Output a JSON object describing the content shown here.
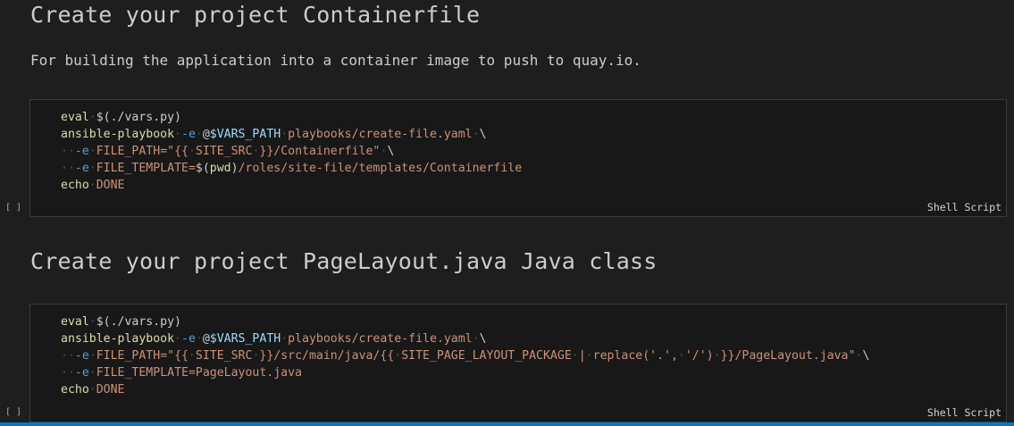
{
  "cells": [
    {
      "type": "markdown",
      "heading": "Create your project Containerfile",
      "paragraph": "For building the application into a container image to push to quay.io."
    },
    {
      "type": "code",
      "execution_count": "[ ]",
      "language": "Shell Script",
      "lines": [
        [
          [
            "cmd",
            "eval"
          ],
          [
            "ws",
            "·"
          ],
          [
            "plain",
            "$(./vars.py)"
          ]
        ],
        [
          [
            "cmd",
            "ansible-playbook"
          ],
          [
            "ws",
            "·"
          ],
          [
            "flag",
            "-e"
          ],
          [
            "ws",
            "·"
          ],
          [
            "plain",
            "@"
          ],
          [
            "var",
            "$VARS_PATH"
          ],
          [
            "ws",
            "·"
          ],
          [
            "str",
            "playbooks/create-file.yaml"
          ],
          [
            "ws",
            "·"
          ],
          [
            "plain",
            "\\"
          ]
        ],
        [
          [
            "ws",
            "··"
          ],
          [
            "flag",
            "-e"
          ],
          [
            "ws",
            "·"
          ],
          [
            "str",
            "FILE_PATH=\"{{"
          ],
          [
            "ws",
            "·"
          ],
          [
            "str",
            "SITE_SRC"
          ],
          [
            "ws",
            "·"
          ],
          [
            "str",
            "}}/Containerfile\""
          ],
          [
            "ws",
            "·"
          ],
          [
            "plain",
            "\\"
          ]
        ],
        [
          [
            "ws",
            "··"
          ],
          [
            "flag",
            "-e"
          ],
          [
            "ws",
            "·"
          ],
          [
            "str",
            "FILE_TEMPLATE="
          ],
          [
            "plain",
            "$("
          ],
          [
            "cmd",
            "pwd"
          ],
          [
            "plain",
            ")"
          ],
          [
            "str",
            "/roles/site-file/templates/Containerfile"
          ]
        ],
        [
          [
            "cmd",
            "echo"
          ],
          [
            "ws",
            "·"
          ],
          [
            "str",
            "DONE"
          ]
        ]
      ]
    },
    {
      "type": "markdown",
      "heading": "Create your project PageLayout.java Java class"
    },
    {
      "type": "code",
      "execution_count": "[ ]",
      "language": "Shell Script",
      "lines": [
        [
          [
            "cmd",
            "eval"
          ],
          [
            "ws",
            "·"
          ],
          [
            "plain",
            "$(./vars.py)"
          ]
        ],
        [
          [
            "cmd",
            "ansible-playbook"
          ],
          [
            "ws",
            "·"
          ],
          [
            "flag",
            "-e"
          ],
          [
            "ws",
            "·"
          ],
          [
            "plain",
            "@"
          ],
          [
            "var",
            "$VARS_PATH"
          ],
          [
            "ws",
            "·"
          ],
          [
            "str",
            "playbooks/create-file.yaml"
          ],
          [
            "ws",
            "·"
          ],
          [
            "plain",
            "\\"
          ]
        ],
        [
          [
            "ws",
            "··"
          ],
          [
            "flag",
            "-e"
          ],
          [
            "ws",
            "·"
          ],
          [
            "str",
            "FILE_PATH=\"{{"
          ],
          [
            "ws",
            "·"
          ],
          [
            "str",
            "SITE_SRC"
          ],
          [
            "ws",
            "·"
          ],
          [
            "str",
            "}}/src/main/java/{{"
          ],
          [
            "ws",
            "·"
          ],
          [
            "str",
            "SITE_PAGE_LAYOUT_PACKAGE"
          ],
          [
            "ws",
            "·"
          ],
          [
            "str",
            "|"
          ],
          [
            "ws",
            "·"
          ],
          [
            "str",
            "replace('.',"
          ],
          [
            "ws",
            "·"
          ],
          [
            "str",
            "'/')"
          ],
          [
            "ws",
            "·"
          ],
          [
            "str",
            "}}/PageLayout.java\""
          ],
          [
            "ws",
            "·"
          ],
          [
            "plain",
            "\\"
          ]
        ],
        [
          [
            "ws",
            "··"
          ],
          [
            "flag",
            "-e"
          ],
          [
            "ws",
            "·"
          ],
          [
            "str",
            "FILE_TEMPLATE=PageLayout.java"
          ]
        ],
        [
          [
            "cmd",
            "echo"
          ],
          [
            "ws",
            "·"
          ],
          [
            "str",
            "DONE"
          ]
        ]
      ]
    }
  ]
}
